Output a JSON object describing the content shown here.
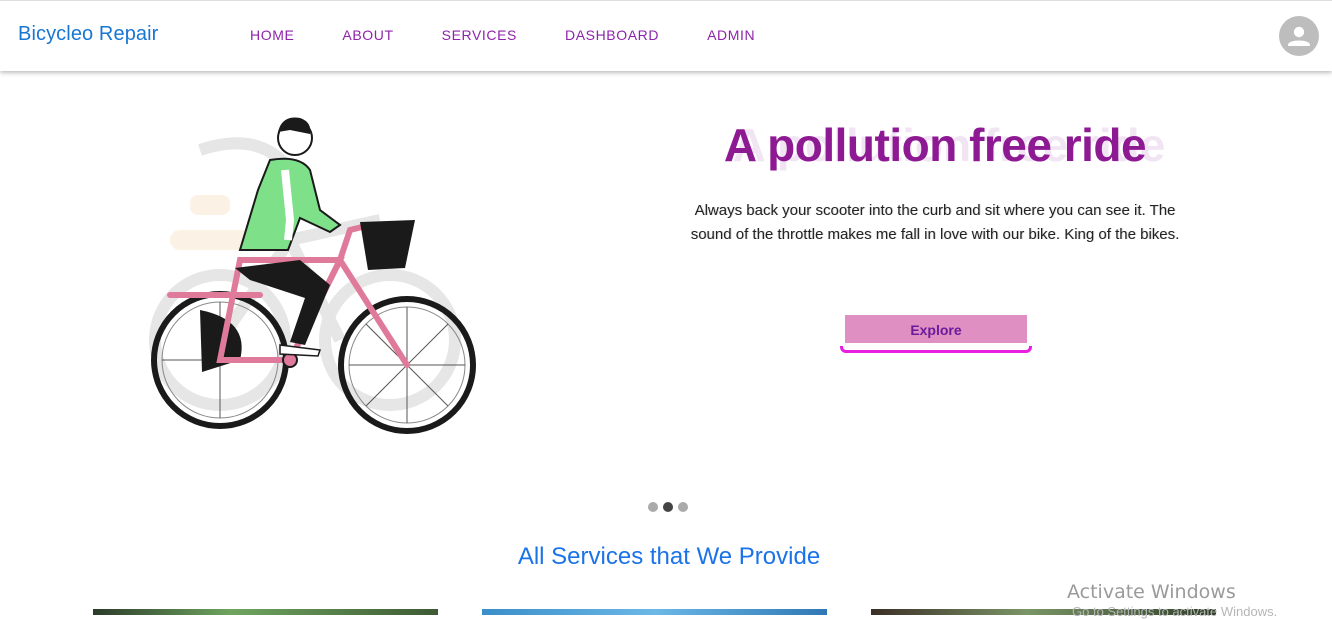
{
  "appbar": {
    "brand": "Bicycleo Repair",
    "nav": [
      {
        "label": "HOME"
      },
      {
        "label": "ABOUT"
      },
      {
        "label": "SERVICES"
      },
      {
        "label": "DASHBOARD"
      },
      {
        "label": "ADMIN"
      }
    ],
    "avatar_icon": "account-circle-icon"
  },
  "hero": {
    "title": "A pollution free ride",
    "description": "Always back your scooter into the curb and sit where you can see it. The sound of the throttle makes me fall in love with our bike. King of the bikes.",
    "explore_label": "Explore",
    "slides": [
      {
        "active": false
      },
      {
        "active": true
      },
      {
        "active": false
      }
    ]
  },
  "services": {
    "title": "All Services that We Provide"
  },
  "watermark": {
    "title": "Activate Windows",
    "subtitle": "Go to Settings to activate Windows."
  },
  "colors": {
    "brand": "#1976d2",
    "nav": "#8e24aa",
    "title": "#8e1a93",
    "button": "#e08fc3",
    "underline": "#e91ee3"
  }
}
